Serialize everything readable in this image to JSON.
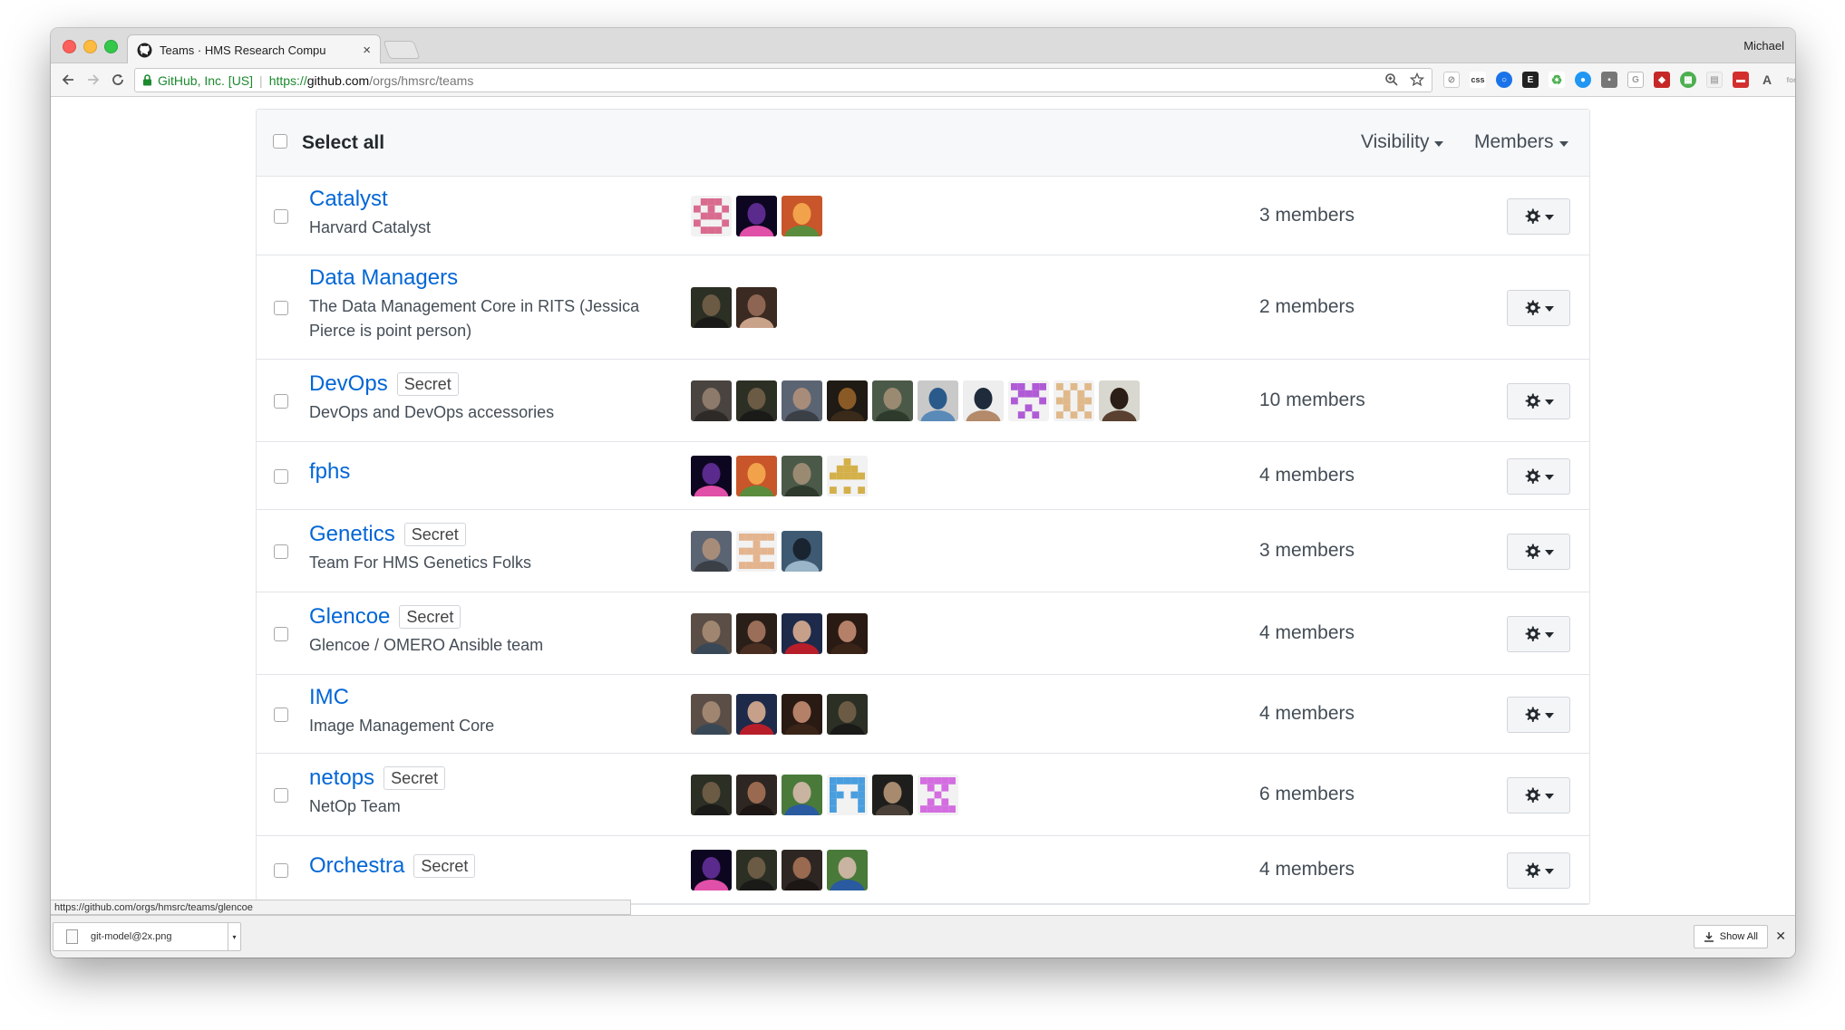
{
  "browser": {
    "tab_title": "Teams · HMS Research Compu",
    "profile_name": "Michael",
    "secure_label": "GitHub, Inc. [US]",
    "url_protocol": "https://",
    "url_host": "github.com",
    "url_path": "/orgs/hmsrc/teams",
    "status_url": "https://github.com/orgs/hmsrc/teams/glencoe",
    "download_filename": "git-model@2x.png",
    "show_all_label": "Show All",
    "extension_icons": [
      "no-entry-icon",
      "css-icon",
      "circle-icon",
      "evernote-icon",
      "recycle-icon",
      "chat-icon",
      "pocket-icon",
      "g-icon",
      "shield-icon",
      "grid-icon",
      "stripe-icon",
      "font-a-icon",
      "font-icon",
      "menu-icon"
    ]
  },
  "teams_header": {
    "select_all_label": "Select all",
    "visibility_label": "Visibility",
    "members_label": "Members"
  },
  "teams": [
    {
      "name": "Catalyst",
      "secret_label": "",
      "description": "Harvard Catalyst",
      "members_label": "3 members",
      "avatars": [
        "pattern-pink",
        "photo-purple-glow",
        "photo-orange-face"
      ]
    },
    {
      "name": "Data Managers",
      "secret_label": "",
      "description": "The Data Management Core in RITS (Jessica Pierce is point person)",
      "members_label": "2 members",
      "avatars": [
        "photo-bearded",
        "photo-woman"
      ]
    },
    {
      "name": "DevOps",
      "secret_label": "Secret",
      "description": "DevOps and DevOps accessories",
      "members_label": "10 members",
      "avatars": [
        "photo-man-1",
        "photo-bearded",
        "photo-man-2",
        "photo-dots",
        "photo-man-3",
        "photo-circle-blue",
        "photo-man-suit",
        "pattern-purple",
        "pattern-tan",
        "photo-man-dark"
      ]
    },
    {
      "name": "fphs",
      "secret_label": "",
      "description": "",
      "members_label": "4 members",
      "avatars": [
        "photo-purple-glow",
        "photo-orange-face",
        "photo-man-3",
        "pattern-gold"
      ]
    },
    {
      "name": "Genetics",
      "secret_label": "Secret",
      "description": "Team For HMS Genetics Folks",
      "members_label": "3 members",
      "avatars": [
        "photo-man-2",
        "pattern-peach",
        "photo-laptop"
      ]
    },
    {
      "name": "Glencoe",
      "secret_label": "Secret",
      "description": "Glencoe / OMERO Ansible team",
      "members_label": "4 members",
      "avatars": [
        "photo-man-glasses",
        "photo-woman-2",
        "photo-man-4",
        "photo-man-red"
      ]
    },
    {
      "name": "IMC",
      "secret_label": "",
      "description": "Image Management Core",
      "members_label": "4 members",
      "avatars": [
        "photo-man-glasses",
        "photo-man-4",
        "photo-man-red",
        "photo-bearded"
      ]
    },
    {
      "name": "netops",
      "secret_label": "Secret",
      "description": "NetOp Team",
      "members_label": "6 members",
      "avatars": [
        "photo-bearded",
        "photo-man-bald",
        "photo-man-flowers",
        "pattern-blue",
        "photo-man-5",
        "pattern-violet"
      ]
    },
    {
      "name": "Orchestra",
      "secret_label": "Secret",
      "description": "",
      "members_label": "4 members",
      "avatars": [
        "photo-purple-glow",
        "photo-bearded",
        "photo-man-bald",
        "photo-man-flowers"
      ]
    }
  ]
}
